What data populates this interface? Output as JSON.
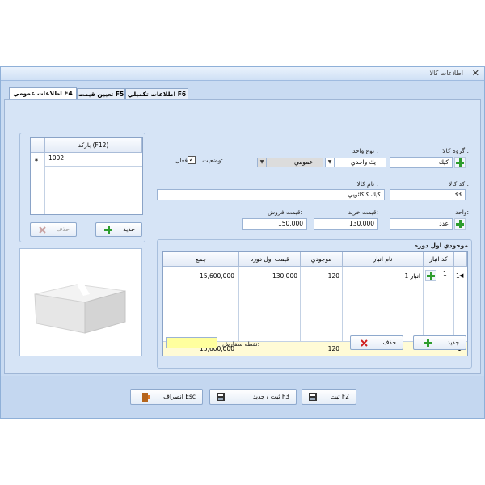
{
  "window": {
    "title": "اطلاعات كالا",
    "close_glyph": "✕"
  },
  "tabs": [
    {
      "label": "اطلاعات عمومي F4",
      "active": true
    },
    {
      "label": "تعيين قيمت F5",
      "active": false
    },
    {
      "label": "اطلاعات تكميلي F6",
      "active": false
    }
  ],
  "form": {
    "group_label": "گروه كالا :",
    "group_value": "كيك",
    "unit_type_label": "نوع واحد :",
    "unit_type_value": "يك واحدي",
    "general_value": "عمومي",
    "status_label": "وضعيت:",
    "active_label": "فعال",
    "active_checked": true,
    "code_label": "كد كالا :",
    "code_value": "33",
    "name_label": "نام كالا :",
    "name_value": "كيك كاكائويي",
    "unit_label": "واحد:",
    "unit_value": "عدد",
    "buy_price_label": "قيمت خريد:",
    "buy_price_value": "130,000",
    "sell_price_label": "قيمت فروش:",
    "sell_price_value": "150,000"
  },
  "barcode": {
    "header": "بارکد (F12)",
    "rows": [
      {
        "marker": "*",
        "value": "1002"
      }
    ],
    "new_label": "جديد",
    "delete_label": "حذف"
  },
  "inventory": {
    "legend": "موجودي اول دوره",
    "headers": [
      "كد انبار",
      "نام انبار",
      "موجودي",
      "قيمت اول دوره",
      "جمع"
    ],
    "rows": [
      {
        "num": "1",
        "code": "1",
        "name": "انبار 1",
        "qty": "120",
        "price": "130,000",
        "total": "15,600,000"
      }
    ],
    "summary": {
      "num": "1",
      "qty": "120",
      "total": "15,600,000"
    },
    "new_label": "جديد",
    "delete_label": "حذف",
    "reorder_label": "نقطه سفارش:",
    "reorder_value": ""
  },
  "footer": {
    "save_label": "ثبت F2",
    "save_new_label": "ثبت / جديد F3",
    "cancel_label": "انصراف Esc"
  },
  "colors": {
    "window_bg": "#c9dbf2",
    "panel_bg": "#d6e4f6",
    "summary_row": "#fffbd6",
    "reorder_field": "#ffff9e",
    "plus_green": "#2e9d2e",
    "delete_red": "#d02020"
  }
}
